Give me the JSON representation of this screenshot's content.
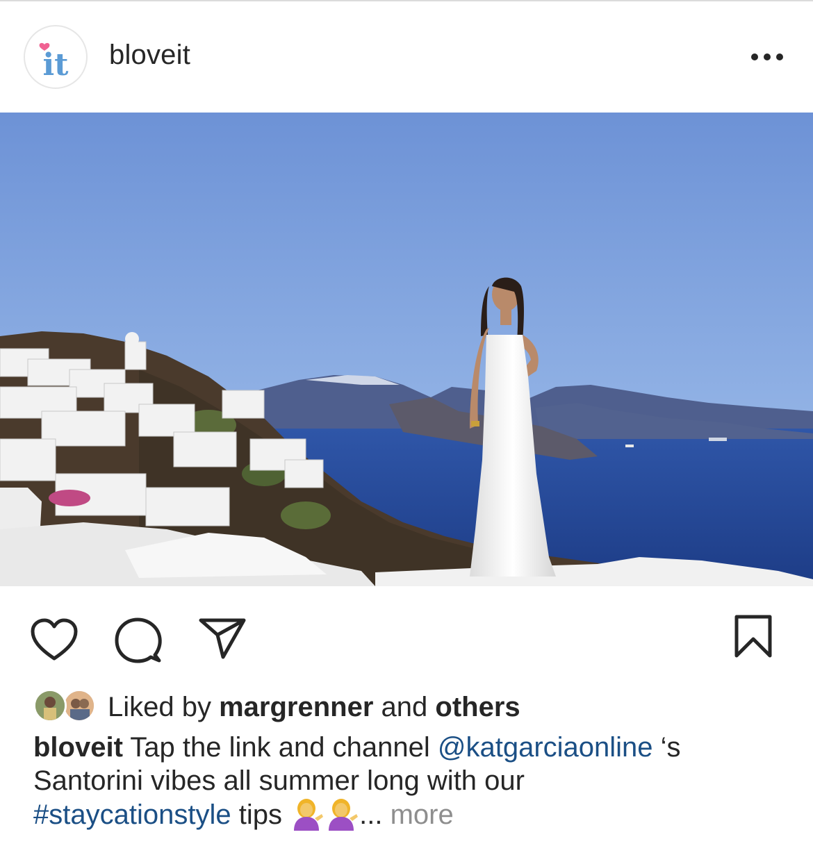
{
  "post": {
    "username": "bloveit",
    "avatar_logo_text": "it",
    "more_icon": "more-horizontal-icon"
  },
  "photo": {
    "alt": "Woman in a white dress on a Santorini rooftop overlooking the caldera"
  },
  "actions": {
    "like_icon": "heart-icon",
    "comment_icon": "comment-icon",
    "share_icon": "send-icon",
    "save_icon": "bookmark-icon"
  },
  "likes": {
    "prefix": "Liked by",
    "user": "margrenner",
    "conjunction": "and",
    "others": "others"
  },
  "caption": {
    "username": "bloveit",
    "text_1": "Tap the link and channel",
    "mention": "@katgarciaonline",
    "text_2": "‘s",
    "line_2": "Santorini vibes all summer long with our",
    "hashtag": "#staycationstyle",
    "text_3": "tips",
    "ellipsis": "...",
    "more": "more"
  },
  "colors": {
    "link": "#1b4f85",
    "muted": "#8e8e8e",
    "logo_blue": "#5b9bd5",
    "logo_heart": "#f06292"
  }
}
